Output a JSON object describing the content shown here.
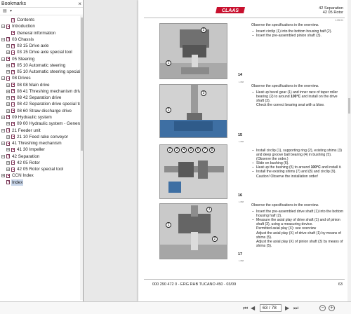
{
  "sidebar": {
    "title": "Bookmarks",
    "close_icon": "close-icon",
    "toolbar_icons": [
      "options-icon",
      "expand-icon"
    ],
    "items": [
      {
        "label": "Contents",
        "level": 1,
        "toggle": "",
        "selected": false
      },
      {
        "label": "Introduction",
        "level": 0,
        "toggle": "−",
        "selected": false
      },
      {
        "label": "General information",
        "level": 1,
        "toggle": "",
        "selected": false
      },
      {
        "label": "03 Chassis",
        "level": 0,
        "toggle": "−",
        "selected": false
      },
      {
        "label": "03 15 Drive axle",
        "level": 1,
        "toggle": "+",
        "selected": false
      },
      {
        "label": "03 15 Drive axle special tool",
        "level": 1,
        "toggle": "+",
        "selected": false
      },
      {
        "label": "05 Steering",
        "level": 0,
        "toggle": "−",
        "selected": false
      },
      {
        "label": "05 10 Automatic steering",
        "level": 1,
        "toggle": "+",
        "selected": false
      },
      {
        "label": "05 10 Automatic steering special t",
        "level": 1,
        "toggle": "+",
        "selected": false
      },
      {
        "label": "08 Drives",
        "level": 0,
        "toggle": "−",
        "selected": false
      },
      {
        "label": "08 08 Main drive",
        "level": 1,
        "toggle": "+",
        "selected": false
      },
      {
        "label": "08 41 Threshing mechanism drive",
        "level": 1,
        "toggle": "+",
        "selected": false
      },
      {
        "label": "08 42 Separation drive",
        "level": 1,
        "toggle": "+",
        "selected": false
      },
      {
        "label": "08 42 Separation drive special tool",
        "level": 1,
        "toggle": "+",
        "selected": false
      },
      {
        "label": "08 60 Straw discharge drive",
        "level": 1,
        "toggle": "+",
        "selected": false
      },
      {
        "label": "09 Hydraulic system",
        "level": 0,
        "toggle": "−",
        "selected": false
      },
      {
        "label": "09 00 Hydraulic system - General",
        "level": 1,
        "toggle": "+",
        "selected": false
      },
      {
        "label": "21 Feeder unit",
        "level": 0,
        "toggle": "−",
        "selected": false
      },
      {
        "label": "21 10 Feed rake conveyor",
        "level": 1,
        "toggle": "+",
        "selected": false
      },
      {
        "label": "41 Threshing mechanism",
        "level": 0,
        "toggle": "−",
        "selected": false
      },
      {
        "label": "41 30 Impeller",
        "level": 1,
        "toggle": "+",
        "selected": false
      },
      {
        "label": "42 Separation",
        "level": 0,
        "toggle": "−",
        "selected": false
      },
      {
        "label": "42 05 Rotor",
        "level": 1,
        "toggle": "+",
        "selected": false
      },
      {
        "label": "42 05 Rotor special tool",
        "level": 1,
        "toggle": "+",
        "selected": false
      },
      {
        "label": "CCN Index",
        "level": 0,
        "toggle": "+",
        "selected": false
      },
      {
        "label": "Index",
        "level": 0,
        "toggle": "",
        "selected": true
      }
    ]
  },
  "page": {
    "brand": "CLAAS",
    "header": {
      "line1": "42 Separation",
      "line2": "42 05 Rotor",
      "code": "1.05.01"
    },
    "figures": [
      {
        "number": "14",
        "code": "1.088",
        "callouts": [
          "2",
          "1"
        ]
      },
      {
        "number": "15",
        "code": "1.088",
        "callouts": [
          "3",
          "1"
        ]
      },
      {
        "number": "16",
        "code": "1.088",
        "callouts": [
          "4",
          "5",
          "6",
          "7",
          "8",
          "3",
          "2"
        ]
      },
      {
        "number": "17",
        "code": "1.088",
        "callouts": [
          "3",
          "1",
          "2"
        ]
      }
    ],
    "steps": [
      {
        "intro": "Observe the specifications in the overview.",
        "lines": [
          "Insert circlip (1) into the bottom housing half (2).",
          "Insert the pre-assembled pinion shaft (3)."
        ]
      },
      {
        "intro": "Observe the specifications in the overview.",
        "lines": [
          "Heat up bevel gear (1) and inner race of taper roller bearing (2) to around 100°C and install on the drive shaft (3).",
          "Check the correct bearing seat with a blow."
        ]
      },
      {
        "intro": "",
        "lines": [
          "Install circlip (1), supporting ring (2), existing shims (3) and deep groove ball bearing (4) in bushing (5).",
          "(Observe the order.)",
          "Slide on bushing (6).",
          "Heat up the bushing (5) to around 100°C and install it.",
          "Install the existing shims (7) and (8) and circlip (9).",
          "Caution! Observe the installation order!"
        ]
      },
      {
        "intro": "Observe the specifications in the overview.",
        "lines": [
          "Insert the pre-assembled drive shaft (1) into the bottom housing half (2).",
          "Measure the axial play of drive shaft (1) and of pinion shaft (3), using a measuring device.",
          "Permitted axial play (X): see overview",
          "Adjust the axial play (X) of drive shaft (1) by means of shims (5).",
          "Adjust the axial play (X) of pinion shaft (3) by means of shims (5)."
        ]
      }
    ],
    "footer": "000 290 472 0 - ERG RHB TUCANO 450 - 03/09",
    "page_number": "63"
  },
  "toolbar": {
    "page_field": "63 / 78",
    "icons": [
      "first-page-icon",
      "previous-page-icon",
      "next-page-icon",
      "last-page-icon",
      "zoom-out-icon",
      "zoom-in-icon"
    ]
  }
}
